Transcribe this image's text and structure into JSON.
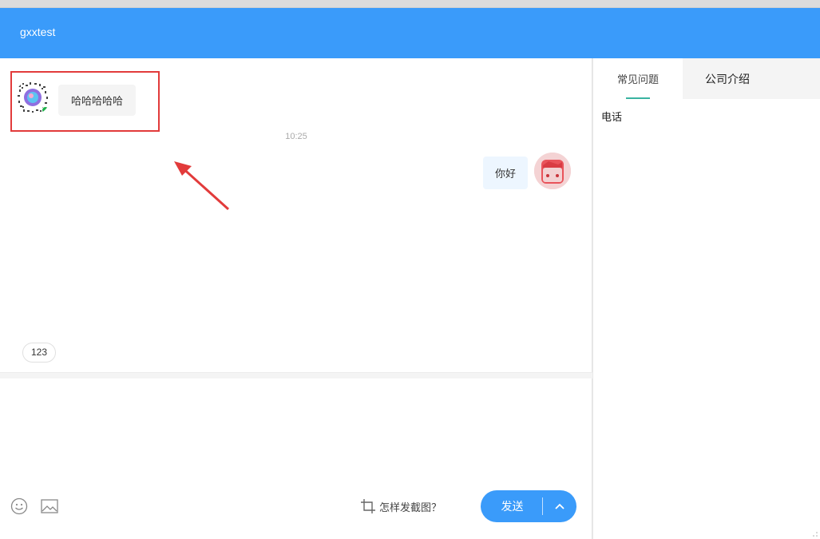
{
  "header": {
    "title": "gxxtest"
  },
  "chat": {
    "incoming": {
      "text": "哈哈哈哈哈"
    },
    "timestamp": "10:25",
    "outgoing": {
      "text": "你好"
    },
    "quick_reply": "123"
  },
  "toolbar": {
    "emoji_icon": "smiley-icon",
    "image_icon": "image-icon",
    "screenshot_help": "怎样发截图？",
    "send_label": "发送"
  },
  "side": {
    "tabs": [
      "常见问题",
      "公司介绍"
    ],
    "content": "电话"
  },
  "colors": {
    "header": "#3a9bfa",
    "accent": "#39b3a1",
    "highlight": "#e23b3b"
  }
}
